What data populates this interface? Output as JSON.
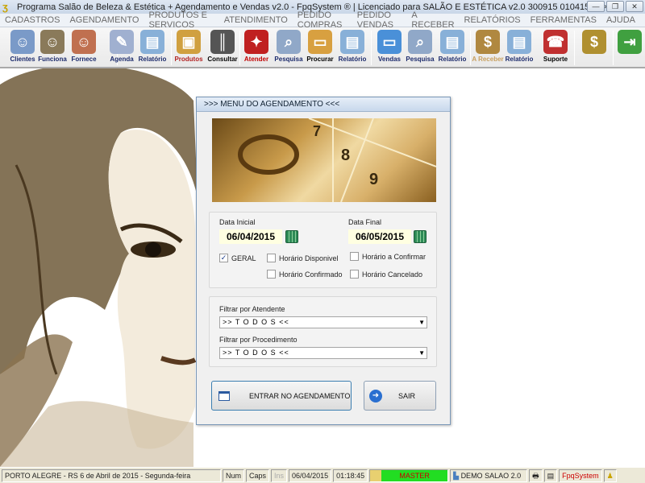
{
  "window": {
    "title": "Programa Salão de Beleza & Estética + Agendamento e Vendas v2.0 - FpqSystem ® | Licenciado para  SALÃO E ESTÉTICA v2.0 300915 010415 >>>"
  },
  "menu": [
    "CADASTROS",
    "AGENDAMENTO",
    "PRODUTOS E SERVIÇOS",
    "ATENDIMENTO",
    "PEDIDO COMPRAS",
    "PEDIDO VENDAS",
    "A RECEBER",
    "RELATÓRIOS",
    "FERRAMENTAS",
    "AJUDA"
  ],
  "toolbar": [
    {
      "label": "Clientes",
      "icon": "clients-icon",
      "color": "#1b2a6b"
    },
    {
      "label": "Funciona",
      "icon": "employees-icon",
      "color": "#1b2a6b"
    },
    {
      "label": "Fornece",
      "icon": "suppliers-icon",
      "color": "#1b2a6b"
    },
    {
      "label": "Agenda",
      "icon": "agenda-icon",
      "color": "#1b2a6b"
    },
    {
      "label": "Relatório",
      "icon": "printer-icon",
      "color": "#1b2a6b"
    },
    {
      "label": "Produtos",
      "icon": "boxes-icon",
      "color": "#b22222"
    },
    {
      "label": "Consultar",
      "icon": "barcode-icon",
      "color": "#000000"
    },
    {
      "label": "Atender",
      "icon": "atender-icon",
      "color": "#c00000"
    },
    {
      "label": "Pesquisa",
      "icon": "search-docs-icon",
      "color": "#1b2a6b"
    },
    {
      "label": "Procurar",
      "icon": "folder-icon",
      "color": "#000000"
    },
    {
      "label": "Relatório",
      "icon": "printer-icon",
      "color": "#1b2a6b"
    },
    {
      "label": "Vendas",
      "icon": "monitor-icon",
      "color": "#1b2a6b"
    },
    {
      "label": "Pesquisa",
      "icon": "search-docs-icon",
      "color": "#1b2a6b"
    },
    {
      "label": "Relatório",
      "icon": "printer-icon",
      "color": "#1b2a6b"
    },
    {
      "label": "A Receber",
      "icon": "money-icon",
      "color": "#c8a060"
    },
    {
      "label": "Relatório",
      "icon": "printer-icon",
      "color": "#1b2a6b"
    },
    {
      "label": "Suporte",
      "icon": "support-icon",
      "color": "#000000"
    },
    {
      "label": "",
      "icon": "coin-icon",
      "color": "#000000"
    },
    {
      "label": "",
      "icon": "exit-icon",
      "color": "#000000"
    }
  ],
  "dialog": {
    "title": ">>>  MENU DO AGENDAMENTO  <<<",
    "data_inicial_label": "Data Inicial",
    "data_inicial": "06/04/2015",
    "data_final_label": "Data Final",
    "data_final": "06/05/2015",
    "checks": {
      "geral": "GERAL",
      "disponivel": "Horário  Disponivel",
      "confirmado": "Horário Confirmado",
      "a_confirmar": "Horário a Confirmar",
      "cancelado": "Horário Cancelado"
    },
    "geral_checked": true,
    "filtro_atendente_label": "Filtrar por Atendente",
    "filtro_atendente": ">> T O D O S <<",
    "filtro_procedimento_label": "Filtrar por Procedimento",
    "filtro_procedimento": ">> T O D O S <<",
    "entrar": "ENTRAR NO AGENDAMENTO",
    "sair": "SAIR",
    "calendar_numbers": [
      "7",
      "8",
      "9"
    ]
  },
  "status": {
    "location": "PORTO ALEGRE - RS  6 de Abril de 2015 - Segunda-feira",
    "num": "Num",
    "caps": "Caps",
    "ins": "Ins",
    "date": "06/04/2015",
    "time": "01:18:45",
    "user": "MASTER",
    "db": "DEMO SALAO 2.0",
    "brand": "FpqSystem"
  }
}
